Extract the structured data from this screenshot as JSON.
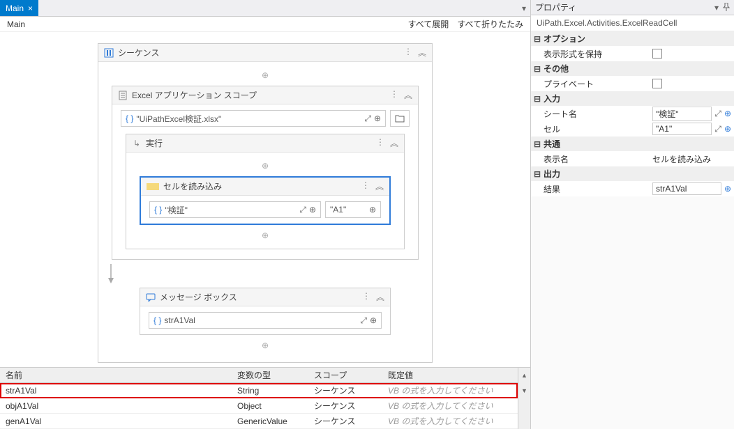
{
  "tab": {
    "title": "Main",
    "close": "×"
  },
  "breadcrumb": {
    "main": "Main",
    "expand_all": "すべて展開",
    "collapse_all": "すべて折りたたみ"
  },
  "seq": {
    "title": "シーケンス"
  },
  "scope": {
    "title": "Excel アプリケーション スコープ",
    "path": "\"UiPathExcel検証.xlsx\""
  },
  "exec": {
    "title": "実行"
  },
  "readcell": {
    "title": "セルを読み込み",
    "sheet": "\"検証\"",
    "cell": "\"A1\""
  },
  "msgbox": {
    "title": "メッセージ ボックス",
    "expr": "strA1Val"
  },
  "vars": {
    "headers": {
      "name": "名前",
      "type": "変数の型",
      "scope": "スコープ",
      "default": "既定値"
    },
    "placeholder": "VB の式を入力してください",
    "rows": [
      {
        "name": "strA1Val",
        "type": "String",
        "scope": "シーケンス"
      },
      {
        "name": "objA1Val",
        "type": "Object",
        "scope": "シーケンス"
      },
      {
        "name": "genA1Val",
        "type": "GenericValue",
        "scope": "シーケンス"
      }
    ]
  },
  "props": {
    "title": "プロパティ",
    "class": "UiPath.Excel.Activities.ExcelReadCell",
    "g_options": "オプション",
    "keep_format": "表示形式を保持",
    "g_other": "その他",
    "private": "プライベート",
    "g_input": "入力",
    "sheet": "シート名",
    "sheet_val": "\"検証\"",
    "cell": "セル",
    "cell_val": "\"A1\"",
    "g_common": "共通",
    "display": "表示名",
    "display_val": "セルを読み込み",
    "g_output": "出力",
    "result": "結果",
    "result_val": "strA1Val"
  },
  "icons": {
    "braces": "{ }",
    "expand_full": "⤢",
    "plus_circ": "⊕",
    "folder": "🗀",
    "more": "⋮",
    "collapse": "︽",
    "minus": "⊟",
    "pin": "📌",
    "arrow": "↓",
    "up": "▲",
    "down": "▼",
    "caret": "▾"
  }
}
